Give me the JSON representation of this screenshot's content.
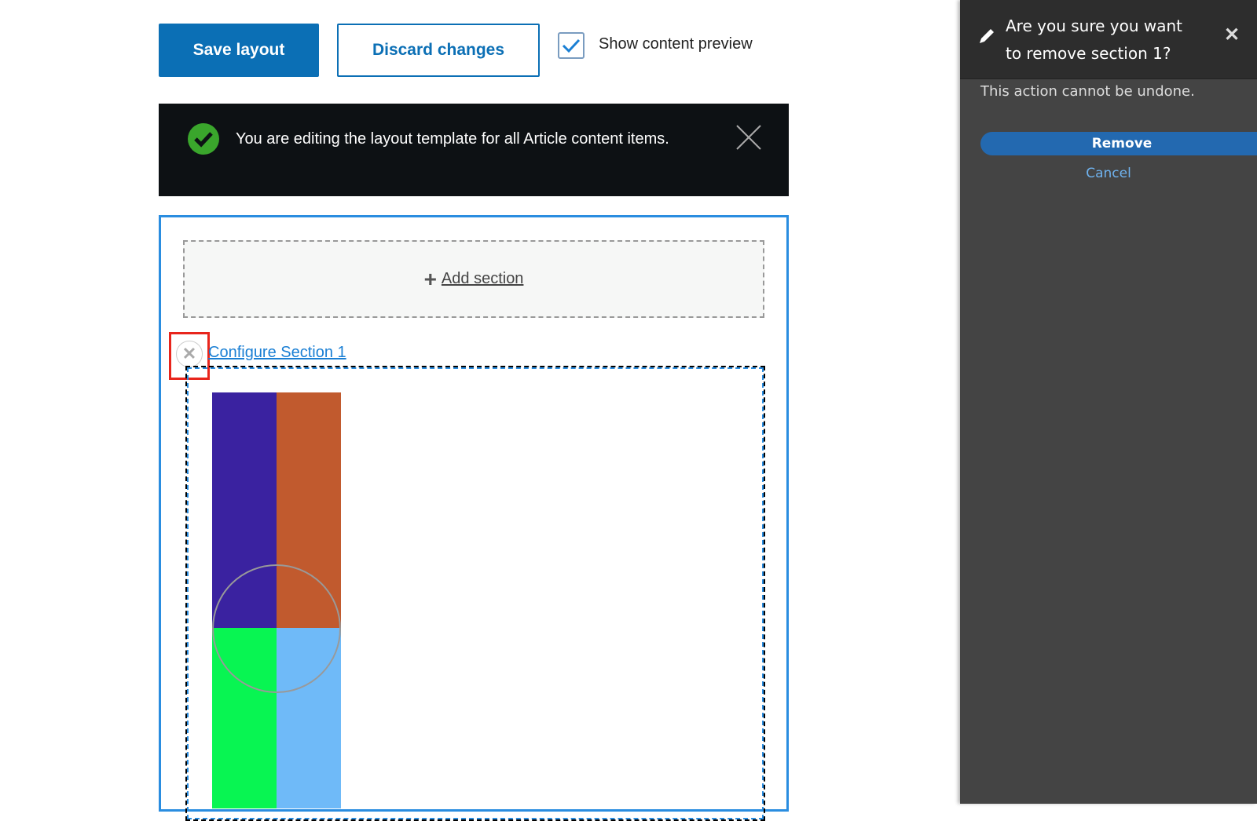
{
  "toolbar": {
    "save_label": "Save layout",
    "discard_label": "Discard changes",
    "preview_label": "Show content preview",
    "preview_checked": true
  },
  "message": {
    "text": "You are editing the layout template for all Article content items."
  },
  "builder": {
    "add_section": "Add section",
    "configure_section": "Configure Section 1"
  },
  "dialog": {
    "title": "Are you sure you want to remove section 1?",
    "description": "This action cannot be undone.",
    "remove_label": "Remove",
    "cancel_label": "Cancel"
  },
  "colors": {
    "accent": "#0b6fb5",
    "region_border": "#2a8de0",
    "highlight": "#e8251c",
    "tiles": [
      "#3a22a0",
      "#c15a2e",
      "#08f552",
      "#6fbaf8"
    ]
  }
}
